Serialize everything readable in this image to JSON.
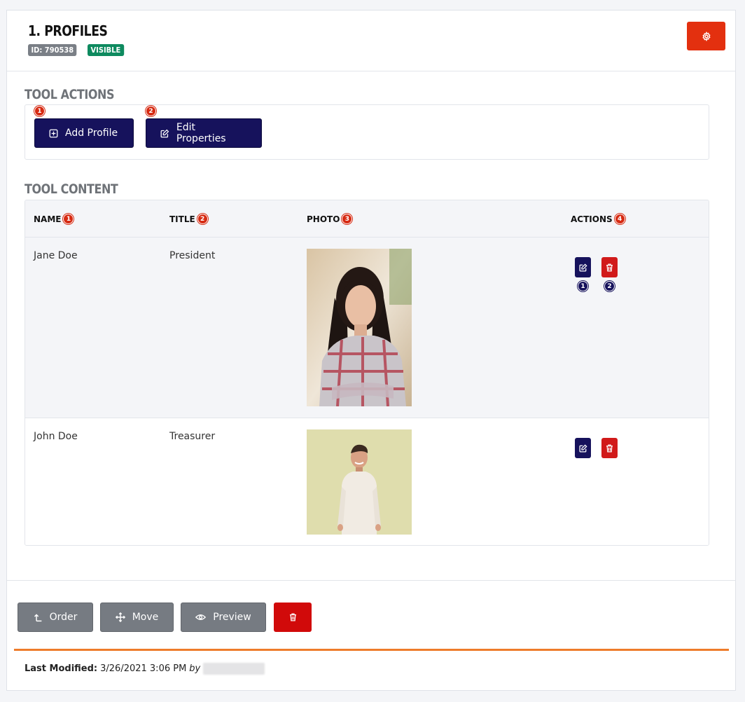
{
  "header": {
    "title": "1. PROFILES",
    "id_badge": "ID: 790538",
    "visibility_badge": "VISIBLE",
    "settings_icon": "gear-icon"
  },
  "tool_actions": {
    "section_title": "TOOL ACTIONS",
    "buttons": [
      {
        "label": "Add Profile",
        "icon": "plus-square-icon",
        "number": "1"
      },
      {
        "label": "Edit Properties",
        "icon": "edit-icon",
        "number": "2"
      }
    ]
  },
  "tool_content": {
    "section_title": "TOOL CONTENT",
    "columns": [
      {
        "label": "NAME",
        "number": "1"
      },
      {
        "label": "TITLE",
        "number": "2"
      },
      {
        "label": "PHOTO",
        "number": "3"
      },
      {
        "label": "ACTIONS",
        "number": "4"
      }
    ],
    "rows": [
      {
        "name": "Jane Doe",
        "title": "President",
        "photo": "portrait of a woman with long dark hair in a plaid shirt",
        "edit_number": "1",
        "delete_number": "2"
      },
      {
        "name": "John Doe",
        "title": "Treasurer",
        "photo": "portrait of a man in a cream sweater on a light green background"
      }
    ]
  },
  "footer": {
    "buttons": [
      {
        "label": "Order",
        "icon": "order-arrow-icon"
      },
      {
        "label": "Move",
        "icon": "move-arrows-icon"
      },
      {
        "label": "Preview",
        "icon": "eye-icon"
      }
    ],
    "delete_icon": "trash-icon",
    "last_modified_label": "Last Modified:",
    "last_modified_value": "3/26/2021 3:06 PM",
    "by_label": "by"
  },
  "colors": {
    "navy": "#16125c",
    "red": "#d11a1a",
    "settings_red": "#e3300f",
    "gray_button": "#767b82",
    "green_badge": "#0e8a5f",
    "orange_line": "#ee7c2b"
  }
}
